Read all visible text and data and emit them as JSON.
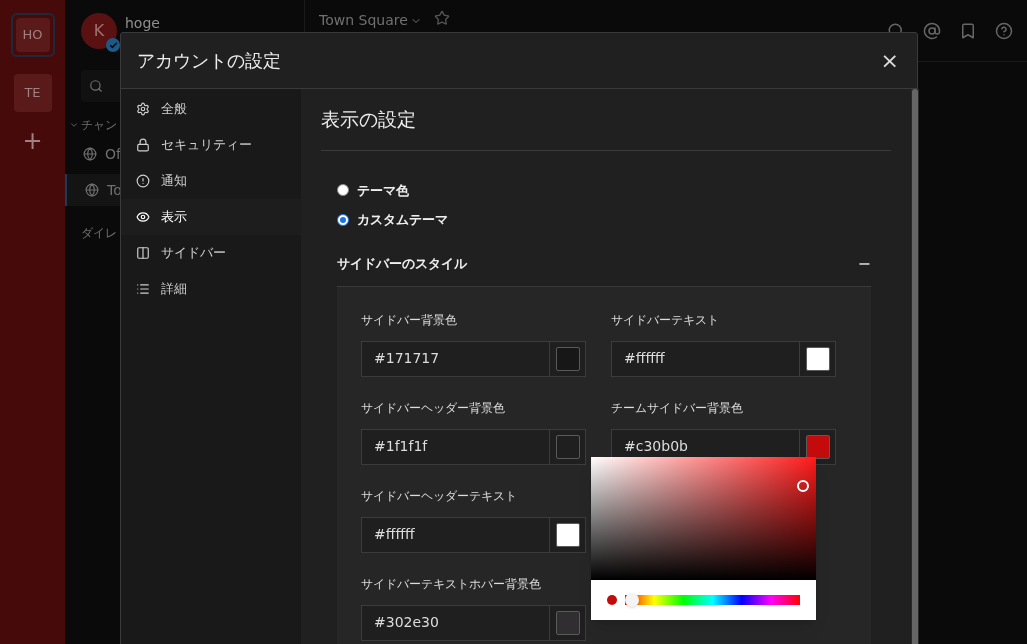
{
  "teams": [
    {
      "label": "HO",
      "selected": true
    },
    {
      "label": "TE",
      "selected": false
    }
  ],
  "add_team": "+",
  "user": {
    "initial": "K",
    "name": "hoge"
  },
  "channel_sidebar": {
    "section": "チャン",
    "channels": [
      {
        "label": "Of",
        "selected": false
      },
      {
        "label": "To",
        "selected": true
      }
    ],
    "direct": "ダイレ"
  },
  "channel_header": {
    "name": "Town Square"
  },
  "modal": {
    "title": "アカウントの設定",
    "close": "×",
    "nav": [
      {
        "label": "全般",
        "selected": false
      },
      {
        "label": "セキュリティー",
        "selected": false
      },
      {
        "label": "通知",
        "selected": false
      },
      {
        "label": "表示",
        "selected": true
      },
      {
        "label": "サイドバー",
        "selected": false
      },
      {
        "label": "詳細",
        "selected": false
      }
    ],
    "heading": "表示の設定",
    "theme_options": [
      {
        "label": "テーマ色",
        "selected": false
      },
      {
        "label": "カスタムテーマ",
        "selected": true
      }
    ],
    "section": {
      "title": "サイドバーのスタイル",
      "expanded": true,
      "toggle": "−"
    },
    "field_rows": [
      [
        {
          "label": "サイドバー背景色",
          "value": "#171717",
          "color": "#171717"
        },
        {
          "label": "サイドバーテキスト",
          "value": "#ffffff",
          "color": "#ffffff"
        }
      ],
      [
        {
          "label": "サイドバーヘッダー背景色",
          "value": "#1f1f1f",
          "color": "#1f1f1f"
        },
        {
          "label": "チームサイドバー背景色",
          "value": "#c30b0b",
          "color": "#c30b0b"
        }
      ],
      [
        {
          "label": "サイドバーヘッダーテキスト",
          "value": "#ffffff",
          "color": "#ffffff"
        }
      ],
      [
        {
          "label": "サイドバーテキストホバー背景色",
          "value": "#302e30",
          "color": "#302e30"
        }
      ]
    ],
    "picker": {
      "color": "#c30b0b",
      "level": 0.04
    }
  }
}
